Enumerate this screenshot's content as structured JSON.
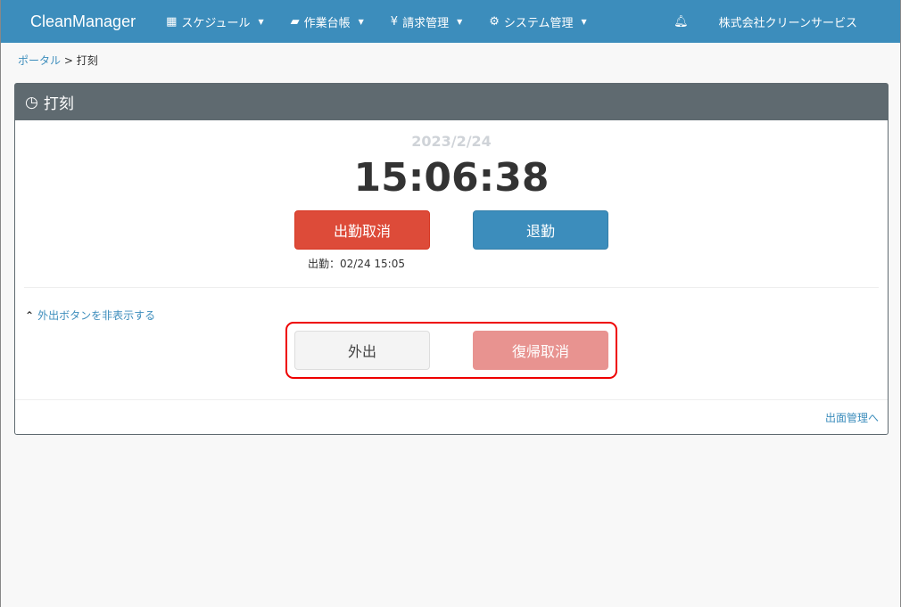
{
  "nav": {
    "brand": "CleanManager",
    "menus": [
      {
        "icon": "calendar-icon",
        "glyph": "▦",
        "label": "スケジュール"
      },
      {
        "icon": "book-icon",
        "glyph": "▰",
        "label": "作業台帳"
      },
      {
        "icon": "yen-icon",
        "glyph": "¥",
        "label": "請求管理"
      },
      {
        "icon": "gears-icon",
        "glyph": "⚙",
        "label": "システム管理"
      }
    ],
    "company": "株式会社クリーンサービス"
  },
  "breadcrumb": {
    "parent": "ポータル",
    "sep": ">",
    "current": "打刻"
  },
  "panel": {
    "title": "打刻",
    "date": "2023/2/24",
    "time": "15:06:38",
    "cancel_clock_in": "出勤取消",
    "clock_out": "退勤",
    "clock_in_note": "出勤：02/24 15:05",
    "hide_toggle": "外出ボタンを非表示する",
    "go_out": "外出",
    "cancel_return": "復帰取消",
    "footer_link": "出面管理へ"
  }
}
